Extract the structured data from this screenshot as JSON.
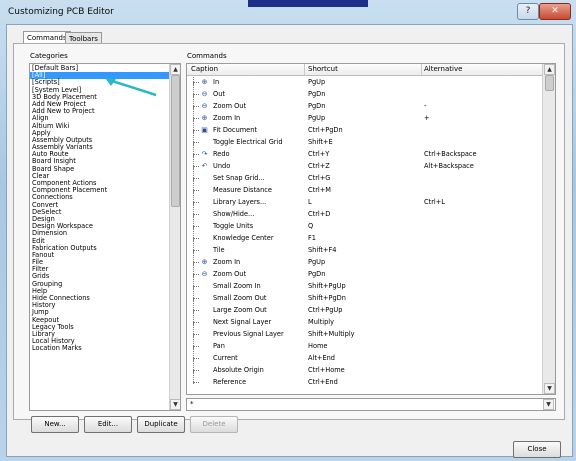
{
  "window": {
    "title": "Customizing PCB Editor",
    "help_glyph": "?",
    "close_glyph": "✕"
  },
  "tabs": [
    "Commands",
    "Toolbars"
  ],
  "categories_label": "Categories",
  "commands_label": "Commands",
  "categories": [
    "[Default Bars]",
    "[All]",
    "[Scripts]",
    "[System Level]",
    "3D Body Placement",
    "Add New Project",
    "Add New to Project",
    "Align",
    "Altium Wiki",
    "Apply",
    "Assembly Outputs",
    "Assembly Variants",
    "Auto Route",
    "Board Insight",
    "Board Shape",
    "Clear",
    "Component Actions",
    "Component Placement",
    "Connections",
    "Convert",
    "DeSelect",
    "Design",
    "Design Workspace",
    "Dimension",
    "Edit",
    "Fabrication Outputs",
    "Fanout",
    "File",
    "Filter",
    "Grids",
    "Grouping",
    "Help",
    "Hide Connections",
    "History",
    "Jump",
    "Keepout",
    "Legacy Tools",
    "Library",
    "Local History",
    "Location Marks"
  ],
  "selected_category_index": 1,
  "columns": [
    "Caption",
    "Shortcut",
    "Alternative"
  ],
  "commands": [
    {
      "caption": "In",
      "shortcut": "PgUp",
      "alt": "",
      "icon": "zoom-in-icon"
    },
    {
      "caption": "Out",
      "shortcut": "PgDn",
      "alt": "",
      "icon": "zoom-out-icon"
    },
    {
      "caption": "Zoom Out",
      "shortcut": "PgDn",
      "alt": "-",
      "icon": "zoom-out-icon"
    },
    {
      "caption": "Zoom In",
      "shortcut": "PgUp",
      "alt": "+",
      "icon": "zoom-in-icon"
    },
    {
      "caption": "Fit Document",
      "shortcut": "Ctrl+PgDn",
      "alt": "",
      "icon": "fit-document-icon"
    },
    {
      "caption": "Toggle Electrical Grid",
      "shortcut": "Shift+E",
      "alt": "",
      "icon": ""
    },
    {
      "caption": "Redo",
      "shortcut": "Ctrl+Y",
      "alt": "Ctrl+Backspace",
      "icon": "redo-icon"
    },
    {
      "caption": "Undo",
      "shortcut": "Ctrl+Z",
      "alt": "Alt+Backspace",
      "icon": "undo-icon"
    },
    {
      "caption": "Set Snap Grid...",
      "shortcut": "Ctrl+G",
      "alt": "",
      "icon": ""
    },
    {
      "caption": "Measure Distance",
      "shortcut": "Ctrl+M",
      "alt": "",
      "icon": ""
    },
    {
      "caption": "Library Layers...",
      "shortcut": "L",
      "alt": "Ctrl+L",
      "icon": ""
    },
    {
      "caption": "Show/Hide...",
      "shortcut": "Ctrl+D",
      "alt": "",
      "icon": ""
    },
    {
      "caption": "Toggle Units",
      "shortcut": "Q",
      "alt": "",
      "icon": ""
    },
    {
      "caption": "Knowledge Center",
      "shortcut": "F1",
      "alt": "",
      "icon": ""
    },
    {
      "caption": "Tile",
      "shortcut": "Shift+F4",
      "alt": "",
      "icon": ""
    },
    {
      "caption": "Zoom In",
      "shortcut": "PgUp",
      "alt": "",
      "icon": "zoom-in-icon"
    },
    {
      "caption": "Zoom Out",
      "shortcut": "PgDn",
      "alt": "",
      "icon": "zoom-out-icon"
    },
    {
      "caption": "Small Zoom In",
      "shortcut": "Shift+PgUp",
      "alt": "",
      "icon": ""
    },
    {
      "caption": "Small Zoom Out",
      "shortcut": "Shift+PgDn",
      "alt": "",
      "icon": ""
    },
    {
      "caption": "Large Zoom Out",
      "shortcut": "Ctrl+PgUp",
      "alt": "",
      "icon": ""
    },
    {
      "caption": "Next Signal Layer",
      "shortcut": "Multiply",
      "alt": "",
      "icon": ""
    },
    {
      "caption": "Previous Signal Layer",
      "shortcut": "Shift+Multiply",
      "alt": "",
      "icon": ""
    },
    {
      "caption": "Pan",
      "shortcut": "Home",
      "alt": "",
      "icon": ""
    },
    {
      "caption": "Current",
      "shortcut": "Alt+End",
      "alt": "",
      "icon": ""
    },
    {
      "caption": "Absolute Origin",
      "shortcut": "Ctrl+Home",
      "alt": "",
      "icon": ""
    },
    {
      "caption": "Reference",
      "shortcut": "Ctrl+End",
      "alt": "",
      "icon": ""
    }
  ],
  "filter_value": "*",
  "buttons": {
    "new": "New...",
    "edit": "Edit...",
    "duplicate": "Duplicate",
    "delete": "Delete",
    "close": "Close"
  },
  "colors": {
    "selection": "#3399ff",
    "annotation_arrow": "#2bb7c9"
  }
}
